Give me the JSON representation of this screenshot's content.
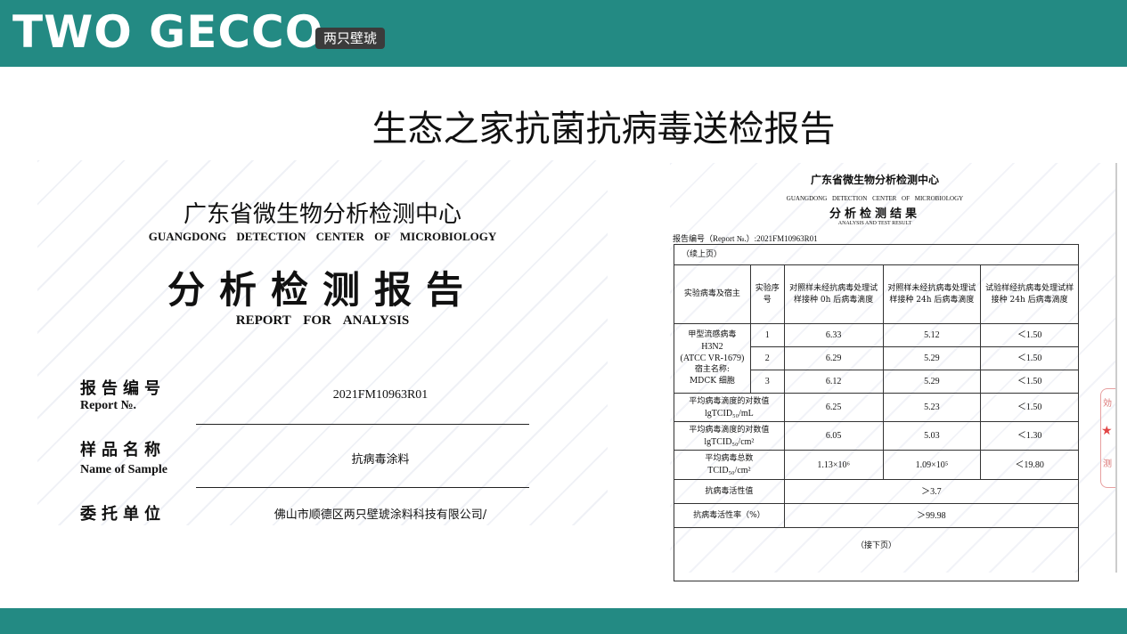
{
  "header": {
    "logo_text": "TWO GECCO",
    "logo_badge": "两只壁琥"
  },
  "slide": {
    "title": "生态之家抗菌抗病毒送检报告"
  },
  "cover": {
    "center_name": "广东省微生物分析检测中心",
    "center_name_en": "GUANGDONG DETECTION CENTER OF MICROBIOLOGY",
    "report_title": "分析检测报告",
    "report_title_en": "REPORT FOR ANALYSIS",
    "fields": [
      {
        "label": "报告编号",
        "label_en": "Report №.",
        "value": "2021FM10963R01"
      },
      {
        "label": "样品名称",
        "label_en": "Name of Sample",
        "value": "抗病毒涂料"
      },
      {
        "label": "委托单位",
        "label_en": "",
        "value": "佛山市顺德区两只壁琥涂料科技有限公司/"
      }
    ]
  },
  "result": {
    "title": "广东省微生物分析检测中心",
    "title_en": "GUANGDONG DETECTION CENTER OF MICROBIOLOGY",
    "subtitle": "分析检测结果",
    "subtitle_en": "ANALYSIS AND TEST RESULT",
    "report_no_label": "报告编号（Report №.）:",
    "report_no": "2021FM10963R01",
    "continued": "（续上页）",
    "headers": {
      "virus_host": "实验病毒及宿主",
      "seq": "实验序号",
      "col1": "对照样未经抗病毒处理试样接种 0h 后病毒滴度",
      "col2": "对照样未经抗病毒处理试样接种 24h 后病毒滴度",
      "col3": "试验样经抗病毒处理试样接种 24h 后病毒滴度"
    },
    "virus_desc": [
      "甲型流感病毒",
      "H3N2",
      "(ATCC VR-1679)",
      "宿主名称:",
      "MDCK 细胞"
    ],
    "rows": [
      {
        "seq": "1",
        "c1": "6.33",
        "c2": "5.12",
        "c3": "＜1.50"
      },
      {
        "seq": "2",
        "c1": "6.29",
        "c2": "5.29",
        "c3": "＜1.50"
      },
      {
        "seq": "3",
        "c1": "6.12",
        "c2": "5.29",
        "c3": "＜1.50"
      }
    ],
    "summary": [
      {
        "label": "平均病毒滴度的对数值",
        "unit": "lgTCID₅₀/mL",
        "c1": "6.25",
        "c2": "5.23",
        "c3": "＜1.50"
      },
      {
        "label": "平均病毒滴度的对数值",
        "unit": "lgTCID₅₀/cm²",
        "c1": "6.05",
        "c2": "5.03",
        "c3": "＜1.30"
      },
      {
        "label": "平均病毒总数",
        "unit": "TCID₅₀/cm²",
        "c1": "1.13×10⁶",
        "c2": "1.09×10⁵",
        "c3": "＜19.80"
      }
    ],
    "activity": {
      "label": "抗病毒活性值",
      "value": "＞3.7"
    },
    "activity_rate": {
      "label": "抗病毒活性率（%）",
      "value": "＞99.98"
    },
    "continue_next": "（接下页）"
  },
  "stamp": {
    "text_top": "効",
    "text_bottom": "测"
  },
  "colors": {
    "brand_teal": "#238a83",
    "badge_dark": "#3b3b3b",
    "stamp_red": "#e24545"
  }
}
